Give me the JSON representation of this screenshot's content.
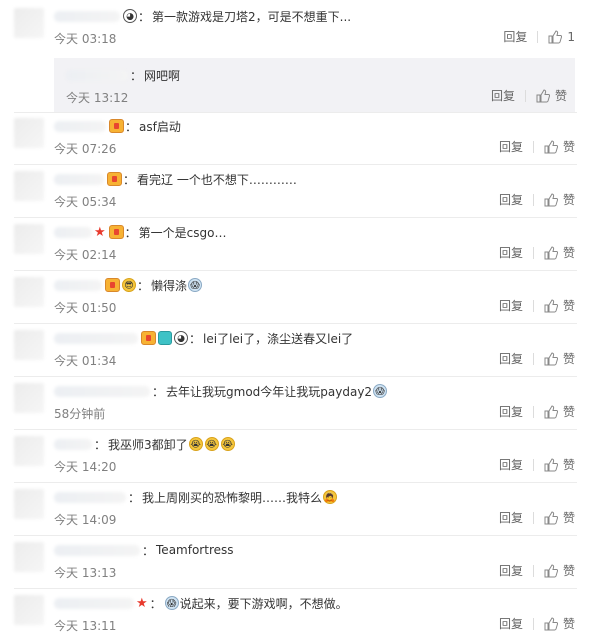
{
  "comments": [
    {
      "text": "第一款游戏是刀塔2，可是不想重下...",
      "time": "今天 03:18",
      "reply": "回复",
      "like": "1",
      "sub": {
        "text": "网吧啊",
        "time": "今天 13:12",
        "reply": "回复",
        "like": "赞"
      }
    },
    {
      "text": "asf启动",
      "time": "今天 07:26",
      "reply": "回复",
      "like": "赞"
    },
    {
      "text": "看完辽 一个也不想下…………",
      "time": "今天 05:34",
      "reply": "回复",
      "like": "赞"
    },
    {
      "text": "第一个是csgo…",
      "time": "今天 02:14",
      "reply": "回复",
      "like": "赞"
    },
    {
      "text": "懒得涤",
      "time": "今天 01:50",
      "reply": "回复",
      "like": "赞"
    },
    {
      "text": "lei了lei了，涤尘送春又lei了",
      "time": "今天 01:34",
      "reply": "回复",
      "like": "赞"
    },
    {
      "text": "去年让我玩gmod今年让我玩payday2",
      "time": "58分钟前",
      "reply": "回复",
      "like": "赞"
    },
    {
      "text": "我巫师3都卸了",
      "time": "今天 14:20",
      "reply": "回复",
      "like": "赞"
    },
    {
      "text": "我上周刚买的恐怖黎明……我特么",
      "time": "今天 14:09",
      "reply": "回复",
      "like": "赞"
    },
    {
      "text": "Teamfortress",
      "time": "今天 13:13",
      "reply": "回复",
      "like": "赞"
    },
    {
      "text": "说起来，要下游戏啊，不想做。",
      "time": "今天 13:11",
      "reply": "回复",
      "like": "赞"
    }
  ],
  "icons": {
    "like": "thumbs-up-icon"
  },
  "colors": {
    "muted": "#808080",
    "text": "#333333",
    "subreply_bg": "#f2f2f5",
    "star": "#e83a2e"
  }
}
